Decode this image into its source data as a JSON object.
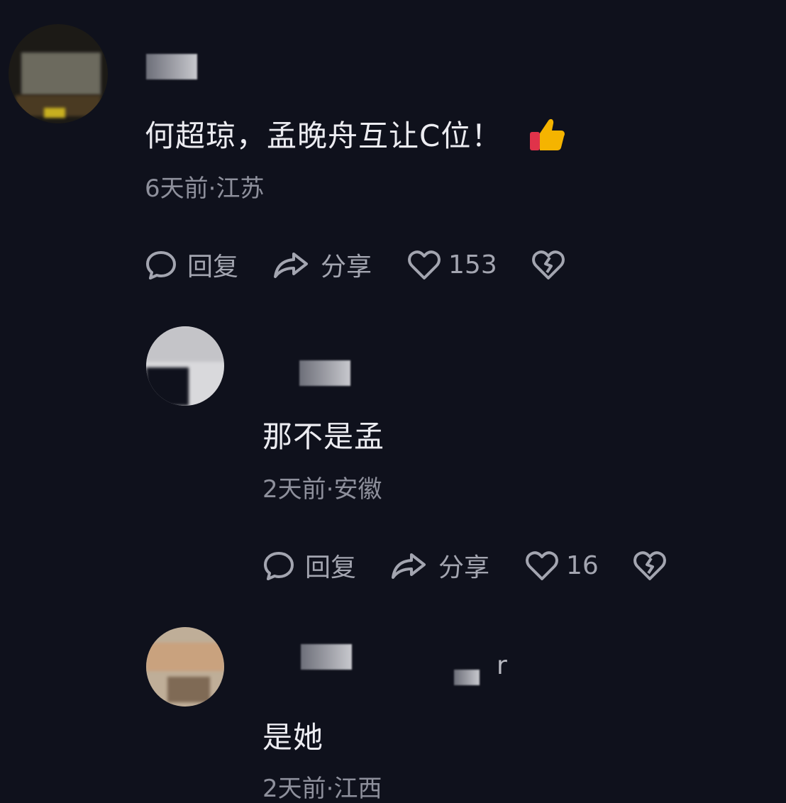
{
  "comments": [
    {
      "text": "何超琼，孟晚舟互让C位！",
      "meta": "6天前·江苏",
      "reply_label": "回复",
      "share_label": "分享",
      "like_count": "153"
    },
    {
      "text": "那不是孟",
      "meta": "2天前·安徽",
      "reply_label": "回复",
      "share_label": "分享",
      "like_count": "16"
    },
    {
      "text": "是她",
      "meta": "2天前·江西",
      "username_fragment": "r"
    }
  ],
  "colors": {
    "background": "#0f111c",
    "text": "#ececf1",
    "meta": "#8e909c",
    "icon": "#a3a5b0"
  }
}
